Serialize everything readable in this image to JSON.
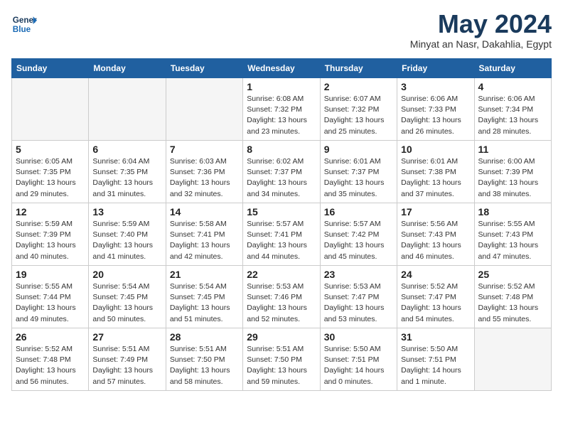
{
  "logo": {
    "line1": "General",
    "line2": "Blue"
  },
  "title": "May 2024",
  "location": "Minyat an Nasr, Dakahlia, Egypt",
  "days_header": [
    "Sunday",
    "Monday",
    "Tuesday",
    "Wednesday",
    "Thursday",
    "Friday",
    "Saturday"
  ],
  "weeks": [
    [
      {
        "day": "",
        "info": ""
      },
      {
        "day": "",
        "info": ""
      },
      {
        "day": "",
        "info": ""
      },
      {
        "day": "1",
        "info": "Sunrise: 6:08 AM\nSunset: 7:32 PM\nDaylight: 13 hours\nand 23 minutes."
      },
      {
        "day": "2",
        "info": "Sunrise: 6:07 AM\nSunset: 7:32 PM\nDaylight: 13 hours\nand 25 minutes."
      },
      {
        "day": "3",
        "info": "Sunrise: 6:06 AM\nSunset: 7:33 PM\nDaylight: 13 hours\nand 26 minutes."
      },
      {
        "day": "4",
        "info": "Sunrise: 6:06 AM\nSunset: 7:34 PM\nDaylight: 13 hours\nand 28 minutes."
      }
    ],
    [
      {
        "day": "5",
        "info": "Sunrise: 6:05 AM\nSunset: 7:35 PM\nDaylight: 13 hours\nand 29 minutes."
      },
      {
        "day": "6",
        "info": "Sunrise: 6:04 AM\nSunset: 7:35 PM\nDaylight: 13 hours\nand 31 minutes."
      },
      {
        "day": "7",
        "info": "Sunrise: 6:03 AM\nSunset: 7:36 PM\nDaylight: 13 hours\nand 32 minutes."
      },
      {
        "day": "8",
        "info": "Sunrise: 6:02 AM\nSunset: 7:37 PM\nDaylight: 13 hours\nand 34 minutes."
      },
      {
        "day": "9",
        "info": "Sunrise: 6:01 AM\nSunset: 7:37 PM\nDaylight: 13 hours\nand 35 minutes."
      },
      {
        "day": "10",
        "info": "Sunrise: 6:01 AM\nSunset: 7:38 PM\nDaylight: 13 hours\nand 37 minutes."
      },
      {
        "day": "11",
        "info": "Sunrise: 6:00 AM\nSunset: 7:39 PM\nDaylight: 13 hours\nand 38 minutes."
      }
    ],
    [
      {
        "day": "12",
        "info": "Sunrise: 5:59 AM\nSunset: 7:39 PM\nDaylight: 13 hours\nand 40 minutes."
      },
      {
        "day": "13",
        "info": "Sunrise: 5:59 AM\nSunset: 7:40 PM\nDaylight: 13 hours\nand 41 minutes."
      },
      {
        "day": "14",
        "info": "Sunrise: 5:58 AM\nSunset: 7:41 PM\nDaylight: 13 hours\nand 42 minutes."
      },
      {
        "day": "15",
        "info": "Sunrise: 5:57 AM\nSunset: 7:41 PM\nDaylight: 13 hours\nand 44 minutes."
      },
      {
        "day": "16",
        "info": "Sunrise: 5:57 AM\nSunset: 7:42 PM\nDaylight: 13 hours\nand 45 minutes."
      },
      {
        "day": "17",
        "info": "Sunrise: 5:56 AM\nSunset: 7:43 PM\nDaylight: 13 hours\nand 46 minutes."
      },
      {
        "day": "18",
        "info": "Sunrise: 5:55 AM\nSunset: 7:43 PM\nDaylight: 13 hours\nand 47 minutes."
      }
    ],
    [
      {
        "day": "19",
        "info": "Sunrise: 5:55 AM\nSunset: 7:44 PM\nDaylight: 13 hours\nand 49 minutes."
      },
      {
        "day": "20",
        "info": "Sunrise: 5:54 AM\nSunset: 7:45 PM\nDaylight: 13 hours\nand 50 minutes."
      },
      {
        "day": "21",
        "info": "Sunrise: 5:54 AM\nSunset: 7:45 PM\nDaylight: 13 hours\nand 51 minutes."
      },
      {
        "day": "22",
        "info": "Sunrise: 5:53 AM\nSunset: 7:46 PM\nDaylight: 13 hours\nand 52 minutes."
      },
      {
        "day": "23",
        "info": "Sunrise: 5:53 AM\nSunset: 7:47 PM\nDaylight: 13 hours\nand 53 minutes."
      },
      {
        "day": "24",
        "info": "Sunrise: 5:52 AM\nSunset: 7:47 PM\nDaylight: 13 hours\nand 54 minutes."
      },
      {
        "day": "25",
        "info": "Sunrise: 5:52 AM\nSunset: 7:48 PM\nDaylight: 13 hours\nand 55 minutes."
      }
    ],
    [
      {
        "day": "26",
        "info": "Sunrise: 5:52 AM\nSunset: 7:48 PM\nDaylight: 13 hours\nand 56 minutes."
      },
      {
        "day": "27",
        "info": "Sunrise: 5:51 AM\nSunset: 7:49 PM\nDaylight: 13 hours\nand 57 minutes."
      },
      {
        "day": "28",
        "info": "Sunrise: 5:51 AM\nSunset: 7:50 PM\nDaylight: 13 hours\nand 58 minutes."
      },
      {
        "day": "29",
        "info": "Sunrise: 5:51 AM\nSunset: 7:50 PM\nDaylight: 13 hours\nand 59 minutes."
      },
      {
        "day": "30",
        "info": "Sunrise: 5:50 AM\nSunset: 7:51 PM\nDaylight: 14 hours\nand 0 minutes."
      },
      {
        "day": "31",
        "info": "Sunrise: 5:50 AM\nSunset: 7:51 PM\nDaylight: 14 hours\nand 1 minute."
      },
      {
        "day": "",
        "info": ""
      }
    ]
  ]
}
